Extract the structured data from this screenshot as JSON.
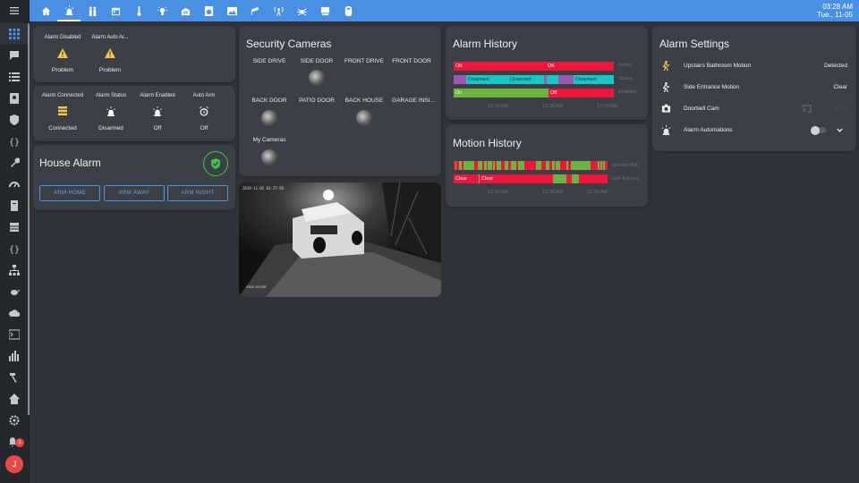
{
  "topbar": {
    "tabs": [
      {
        "icon": "home-icon"
      },
      {
        "icon": "alarm-light-icon",
        "active": true
      },
      {
        "icon": "people-icon"
      },
      {
        "icon": "calendar-icon"
      },
      {
        "icon": "thermometer-icon"
      },
      {
        "icon": "lightbulb-icon"
      },
      {
        "icon": "garage-icon"
      },
      {
        "icon": "washer-icon"
      },
      {
        "icon": "photo-icon"
      },
      {
        "icon": "cctv-icon"
      },
      {
        "icon": "broadcast-icon"
      },
      {
        "icon": "spider-icon"
      },
      {
        "icon": "monitor-icon"
      },
      {
        "icon": "robot-vacuum-icon"
      }
    ],
    "time": "03:28 AM",
    "date": "Tue., 11-05"
  },
  "sidebar": {
    "items": [
      {
        "icon": "grid-icon",
        "active": true
      },
      {
        "icon": "message-icon"
      },
      {
        "icon": "list-icon"
      },
      {
        "icon": "address-book-icon"
      },
      {
        "icon": "shield-icon"
      },
      {
        "icon": "code-braces-icon"
      },
      {
        "icon": "wrench-icon"
      },
      {
        "icon": "gauge-icon"
      },
      {
        "icon": "book-icon"
      },
      {
        "icon": "table-icon"
      },
      {
        "icon": "code-braces-icon"
      },
      {
        "icon": "network-icon"
      },
      {
        "icon": "teapot-icon"
      },
      {
        "icon": "cloud-icon"
      },
      {
        "icon": "console-icon"
      },
      {
        "icon": "chart-icon"
      },
      {
        "icon": "hammer-icon"
      },
      {
        "icon": "home-assistant-icon"
      },
      {
        "icon": "cog-icon"
      }
    ],
    "notification_count": "1",
    "avatar_initial": "J"
  },
  "glance1": {
    "items": [
      {
        "name": "Alarm Disabled",
        "state": "Problem"
      },
      {
        "name": "Alarm Auto Ar...",
        "state": "Problem"
      }
    ]
  },
  "glance2": {
    "items": [
      {
        "name": "Alarm Connected",
        "state": "Connected"
      },
      {
        "name": "Alarm Status",
        "state": "Disarmed"
      },
      {
        "name": "Alarm Enabled",
        "state": "Off"
      },
      {
        "name": "Auto Arm",
        "state": "Off"
      }
    ]
  },
  "house_alarm": {
    "title": "House Alarm",
    "buttons": [
      "ARM HOME",
      "ARM AWAY",
      "ARM NIGHT"
    ]
  },
  "cameras": {
    "title": "Security Cameras",
    "row1": [
      "SIDE DRIVE",
      "SIDE DOOR",
      "FRONT DRIVE",
      "FRONT DOOR"
    ],
    "row2": [
      "BACK DOOR",
      "PATIO DOOR",
      "BACK HOUSE",
      "GARAGE INSI..."
    ],
    "row3": [
      "My Cameras"
    ]
  },
  "camera_feed": {
    "timestamp": "2019-11-05 03:27:58",
    "label": "SIDE DOOR"
  },
  "alarm_history": {
    "title": "Alarm History",
    "rows": [
      {
        "label": "Active",
        "segments": [
          {
            "text": "OK",
            "color": "#f0153d",
            "w": 103
          },
          {
            "text": "OK",
            "color": "#f0153d",
            "w": 76
          }
        ]
      },
      {
        "label": "Status",
        "segments": [
          {
            "text": "",
            "color": "#9b59b6",
            "w": 14
          },
          {
            "text": "Disarmed",
            "color": "#1bc5c5",
            "w": 47
          },
          {
            "text": "Disarmed",
            "color": "#1bc5c5",
            "w": 40
          },
          {
            "text": "",
            "color": "#9b59b6",
            "w": 3
          },
          {
            "text": "",
            "color": "#1bc5c5",
            "w": 13
          },
          {
            "text": "",
            "color": "#9b59b6",
            "w": 17
          },
          {
            "text": "Disarmed",
            "color": "#1bc5c5",
            "w": 45
          }
        ]
      },
      {
        "label": "Enabled",
        "segments": [
          {
            "text": "On",
            "color": "#6db33f",
            "w": 106
          },
          {
            "text": "Off",
            "color": "#f0153d",
            "w": 73
          }
        ]
      }
    ],
    "axis": [
      "12:00 AM",
      "12:00 AM",
      "12:00 AM"
    ]
  },
  "motion_history": {
    "title": "Motion History",
    "row_labels": [
      "Upstairs Bat",
      "Side Entranc"
    ],
    "row2_texts": [
      "Clear",
      "Clear"
    ],
    "axis": [
      "12:00 AM",
      "12:00 AM",
      "12:00 AM"
    ]
  },
  "settings": {
    "title": "Alarm Settings",
    "rows": [
      {
        "icon": "motion-sensor-icon",
        "name": "Upstairs Bathroom Motion",
        "state": "Detected",
        "icon_color": "#f2c94c"
      },
      {
        "icon": "walk-icon",
        "name": "Side Entrance Motion",
        "state": "Clear",
        "icon_color": "#e8e8e8"
      },
      {
        "icon": "camera-icon",
        "name": "Doorbell Cam",
        "state": "IDLE",
        "icon_color": "#e8e8e8"
      },
      {
        "icon": "alarm-light-icon",
        "name": "Alarm Automations",
        "state": "",
        "icon_color": "#e8e8e8"
      }
    ]
  },
  "colors": {
    "accent": "#4a90e2",
    "problem": "#f2c94c",
    "ok_green": "#3fbf4f",
    "red": "#f0153d",
    "teal": "#1bc5c5",
    "purple": "#9b59b6",
    "green": "#6db33f"
  }
}
